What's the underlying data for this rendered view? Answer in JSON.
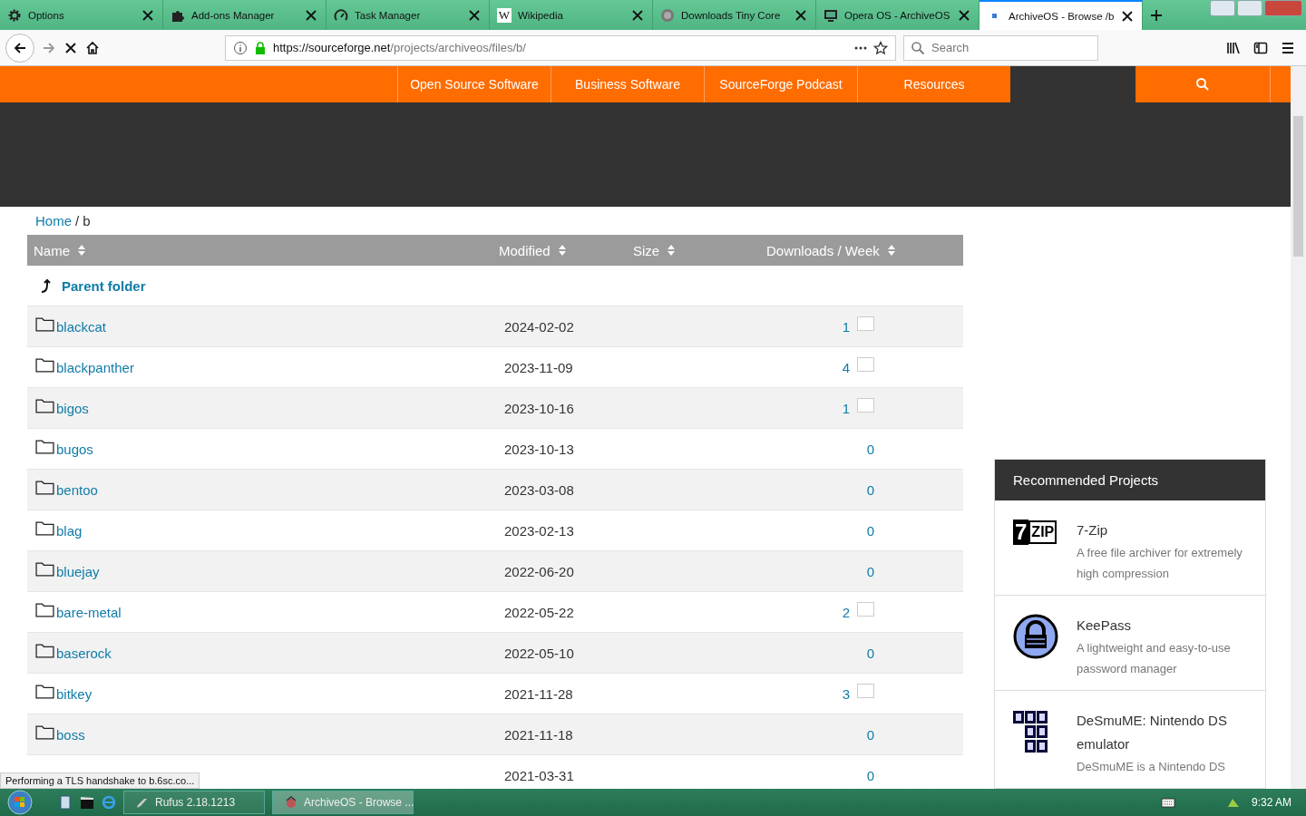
{
  "browser": {
    "tabs": [
      {
        "title": "Options",
        "selected": false
      },
      {
        "title": "Add-ons Manager",
        "selected": false
      },
      {
        "title": "Task Manager",
        "selected": false
      },
      {
        "title": "Wikipedia",
        "glyph": "W",
        "selected": false
      },
      {
        "title": "Downloads Tiny Core",
        "selected": false
      },
      {
        "title": "Opera OS - ArchiveOS",
        "selected": false
      },
      {
        "title": "ArchiveOS - Browse /b",
        "selected": true
      }
    ],
    "url": {
      "host": "https://sourceforge.net",
      "path": "/projects/archiveos/files/b/"
    },
    "search": {
      "placeholder": "Search"
    },
    "status": "Performing a TLS handshake to b.6sc.co..."
  },
  "site_nav": {
    "items": [
      "Open Source Software",
      "Business Software",
      "SourceForge Podcast",
      "Resources"
    ]
  },
  "breadcrumb": {
    "home": "Home",
    "separator": "/",
    "current": "b"
  },
  "table": {
    "columns": [
      "Name",
      "Modified",
      "Size",
      "Downloads / Week"
    ],
    "parent": "Parent folder",
    "rows": [
      {
        "name": "blackcat",
        "modified": "2024-02-02",
        "downloads": "1",
        "graph": true
      },
      {
        "name": "blackpanther",
        "modified": "2023-11-09",
        "downloads": "4",
        "graph": true
      },
      {
        "name": "bigos",
        "modified": "2023-10-16",
        "downloads": "1",
        "graph": true
      },
      {
        "name": "bugos",
        "modified": "2023-10-13",
        "downloads": "0",
        "graph": false
      },
      {
        "name": "bentoo",
        "modified": "2023-03-08",
        "downloads": "0",
        "graph": false
      },
      {
        "name": "blag",
        "modified": "2023-02-13",
        "downloads": "0",
        "graph": false
      },
      {
        "name": "bluejay",
        "modified": "2022-06-20",
        "downloads": "0",
        "graph": false
      },
      {
        "name": "bare-metal",
        "modified": "2022-05-22",
        "downloads": "2",
        "graph": true
      },
      {
        "name": "baserock",
        "modified": "2022-05-10",
        "downloads": "0",
        "graph": false
      },
      {
        "name": "bitkey",
        "modified": "2021-11-28",
        "downloads": "3",
        "graph": true
      },
      {
        "name": "boss",
        "modified": "2021-11-18",
        "downloads": "0",
        "graph": false
      },
      {
        "modified": "2021-03-31",
        "downloads": "0",
        "graph": false
      }
    ]
  },
  "recommended": {
    "title": "Recommended Projects",
    "projects": [
      {
        "name": "7-Zip",
        "description": "A free file archiver for extremely high compression",
        "logo_text": [
          "7",
          "ZIP"
        ]
      },
      {
        "name": "KeePass",
        "description": "A lightweight and easy-to-use password manager"
      },
      {
        "name": "DeSmuME: Nintendo DS emulator",
        "description": "DeSmuME is a Nintendo DS"
      }
    ]
  },
  "taskbar": {
    "tasks": [
      {
        "title": "Rufus 2.18.1213",
        "selected": false
      },
      {
        "title": "ArchiveOS - Browse ...",
        "selected": true
      }
    ],
    "clock": "9:32 AM"
  }
}
